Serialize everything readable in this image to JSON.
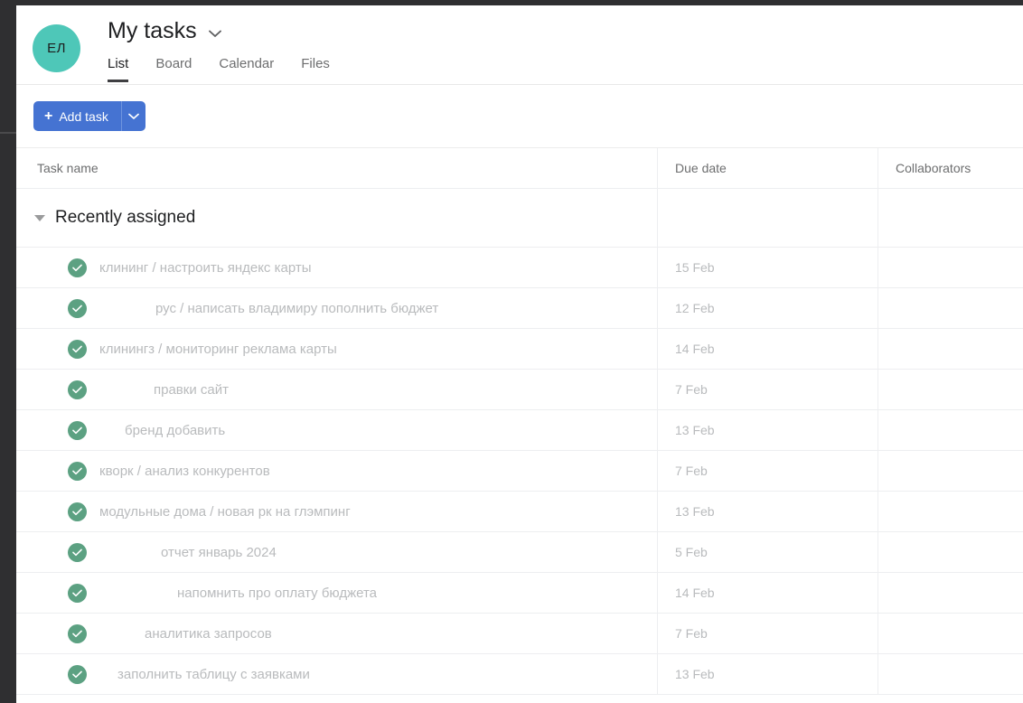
{
  "header": {
    "avatar_initials": "ЕЛ",
    "avatar_color": "#4ec7b8",
    "page_title": "My tasks",
    "title_chevron_icon": "chevron-down-icon",
    "tabs": [
      {
        "label": "List",
        "active": true
      },
      {
        "label": "Board",
        "active": false
      },
      {
        "label": "Calendar",
        "active": false
      },
      {
        "label": "Files",
        "active": false
      }
    ]
  },
  "toolbar": {
    "add_task_label": "Add task",
    "add_task_plus_icon": "plus-icon",
    "add_task_caret_icon": "chevron-down-icon",
    "accent_color": "#4573d2"
  },
  "table": {
    "columns": [
      {
        "label": "Task name"
      },
      {
        "label": "Due date"
      },
      {
        "label": "Collaborators"
      }
    ],
    "section": {
      "label": "Recently assigned",
      "collapse_icon": "triangle-down-icon",
      "expanded": true
    },
    "check_color": "#5ca182",
    "rows": [
      {
        "prefix": "клининг",
        "gap": "",
        "name": " / настроить яндекс карты",
        "due": "15 Feb",
        "collaborators": ""
      },
      {
        "prefix": "",
        "gap": "",
        "name": "рус / написать владимиру пополнить бюджет",
        "due": "12 Feb",
        "collaborators": ""
      },
      {
        "prefix": "клининг",
        "gap": "",
        "name": "з / мониторинг реклама карты",
        "due": "14 Feb",
        "collaborators": ""
      },
      {
        "prefix": "",
        "gap": "",
        "name": "правки сайт",
        "due": "7 Feb",
        "collaborators": ""
      },
      {
        "prefix": "",
        "gap": "",
        "name": "бренд добавить",
        "due": "13 Feb",
        "collaborators": ""
      },
      {
        "prefix": "",
        "gap": "",
        "name": "кворк / анализ конкурентов",
        "due": "7 Feb",
        "collaborators": ""
      },
      {
        "prefix": "",
        "gap": "",
        "name": "модульные дома / новая рк на глэмпинг",
        "due": "13 Feb",
        "collaborators": ""
      },
      {
        "prefix": "",
        "gap": "",
        "name": "отчет январь 2024",
        "due": "5 Feb",
        "collaborators": ""
      },
      {
        "prefix": "",
        "gap": "",
        "name": "напомнить про оплату бюджета",
        "due": "14 Feb",
        "collaborators": ""
      },
      {
        "prefix": "",
        "gap": "",
        "name": "аналитика запросов",
        "due": "7 Feb",
        "collaborators": ""
      },
      {
        "prefix": "",
        "gap": "",
        "name": "заполнить таблицу с заявками",
        "due": "13 Feb",
        "collaborators": ""
      }
    ],
    "row_indents": [
      0,
      62,
      0,
      60,
      28,
      0,
      0,
      68,
      86,
      50,
      20
    ]
  }
}
